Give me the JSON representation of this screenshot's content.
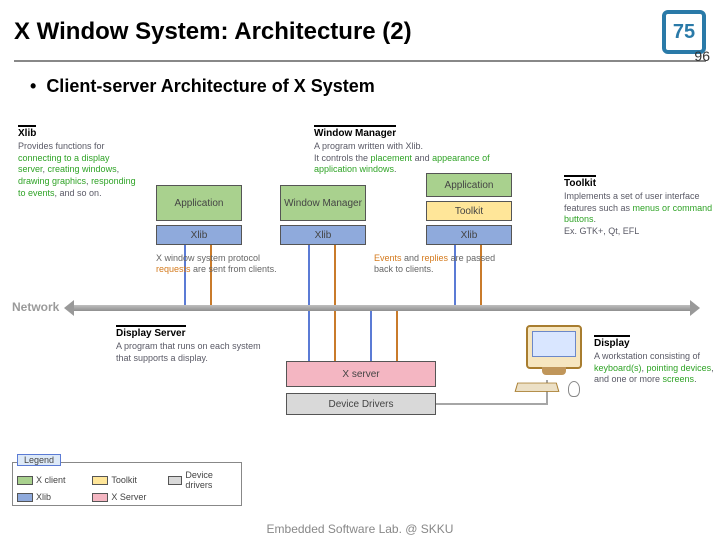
{
  "title": "X Window System: Architecture (2)",
  "page_current": "75",
  "page_total": "96",
  "bullet": "Client-server Architecture of X System",
  "footer": "Embedded Software Lab. @ SKKU",
  "xlib": {
    "header": "Xlib",
    "desc_pre": "Provides functions for ",
    "hl1": "connecting to a display server",
    "sep1": ", ",
    "hl2": "creating windows",
    "sep2": ", ",
    "hl3": "drawing graphics",
    "sep3": ", ",
    "hl4": "responding to events",
    "desc_post": ", and so on."
  },
  "wm": {
    "header": "Window Manager",
    "l1": "A program written with Xlib.",
    "l2a": "It controls the ",
    "hl1": "placement",
    "l2b": " and ",
    "hl2": "appearance of application windows",
    "l2c": "."
  },
  "toolkit": {
    "header": "Toolkit",
    "l1": "Implements a set of user interface features such as ",
    "hl1": "menus or command buttons",
    "l2": ".",
    "l3": "Ex. GTK+, Qt, EFL"
  },
  "network_label": "Network",
  "note_requests_a": "X window system protocol ",
  "note_requests_b": "requests",
  "note_requests_c": " are sent from clients.",
  "note_replies_a": "Events",
  "note_replies_b": " and ",
  "note_replies_c": "replies",
  "note_replies_d": " are passed back to clients.",
  "ds": {
    "header": "Display Server",
    "desc": "A program that runs on each system that supports a display."
  },
  "display": {
    "header": "Display",
    "pre": "A workstation consisting of ",
    "hl1": "keyboard(s)",
    "s1": ", ",
    "hl2": "pointing devices",
    "s2": ", and one or more ",
    "hl3": "screens",
    "post": "."
  },
  "boxes": {
    "app1": "Application",
    "app2": "Application",
    "wm": "Window Manager",
    "tk": "Toolkit",
    "xlib": "Xlib",
    "xserver": "X server",
    "dd": "Device Drivers"
  },
  "legend": {
    "title": "Legend",
    "xclient": "X client",
    "toolkit": "Toolkit",
    "dd": "Device drivers",
    "xlib": "Xlib",
    "xserver": "X Server"
  }
}
